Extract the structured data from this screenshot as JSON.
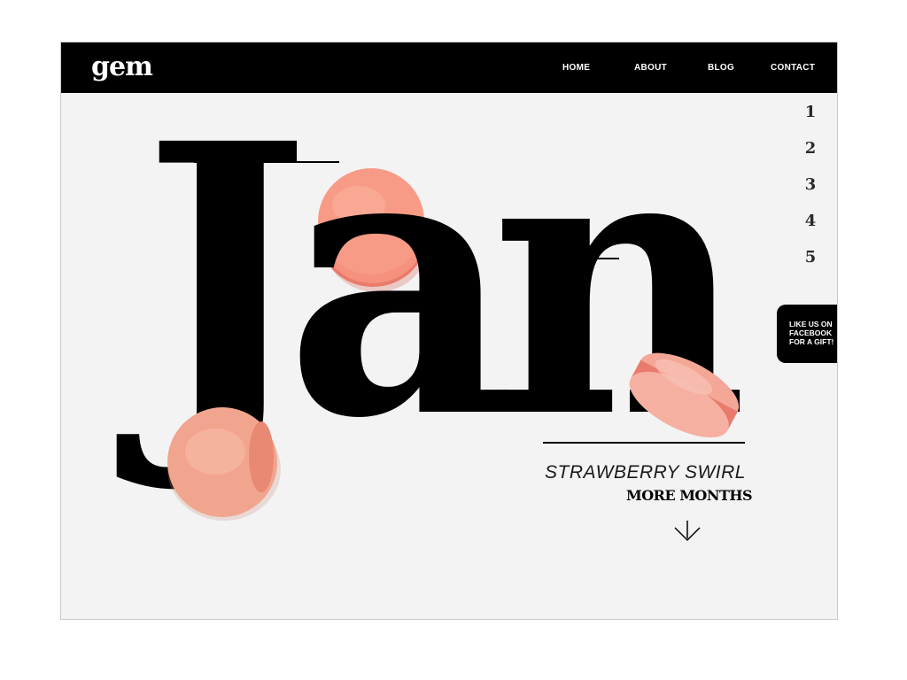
{
  "brand": {
    "logo": "gem"
  },
  "nav": {
    "items": [
      {
        "label": "HOME"
      },
      {
        "label": "ABOUT"
      },
      {
        "label": "BLOG"
      },
      {
        "label": "CONTACT"
      }
    ]
  },
  "hero": {
    "month": "Jan",
    "flavor": "STRAWBERRY SWIRL",
    "more_label": "MORE MONTHS",
    "arrow_icon": "arrow-down-icon"
  },
  "pagination": {
    "items": [
      "1",
      "2",
      "3",
      "4",
      "5"
    ]
  },
  "facebook_tab": {
    "lines": [
      "LIKE US ON",
      "FACEBOOK",
      "FOR A GIFT!"
    ]
  },
  "colors": {
    "navbar": "#000000",
    "background": "#f3f3f4",
    "macaron": "#f59c86",
    "macaron_filling": "#e97a6c",
    "text": "#000000"
  }
}
